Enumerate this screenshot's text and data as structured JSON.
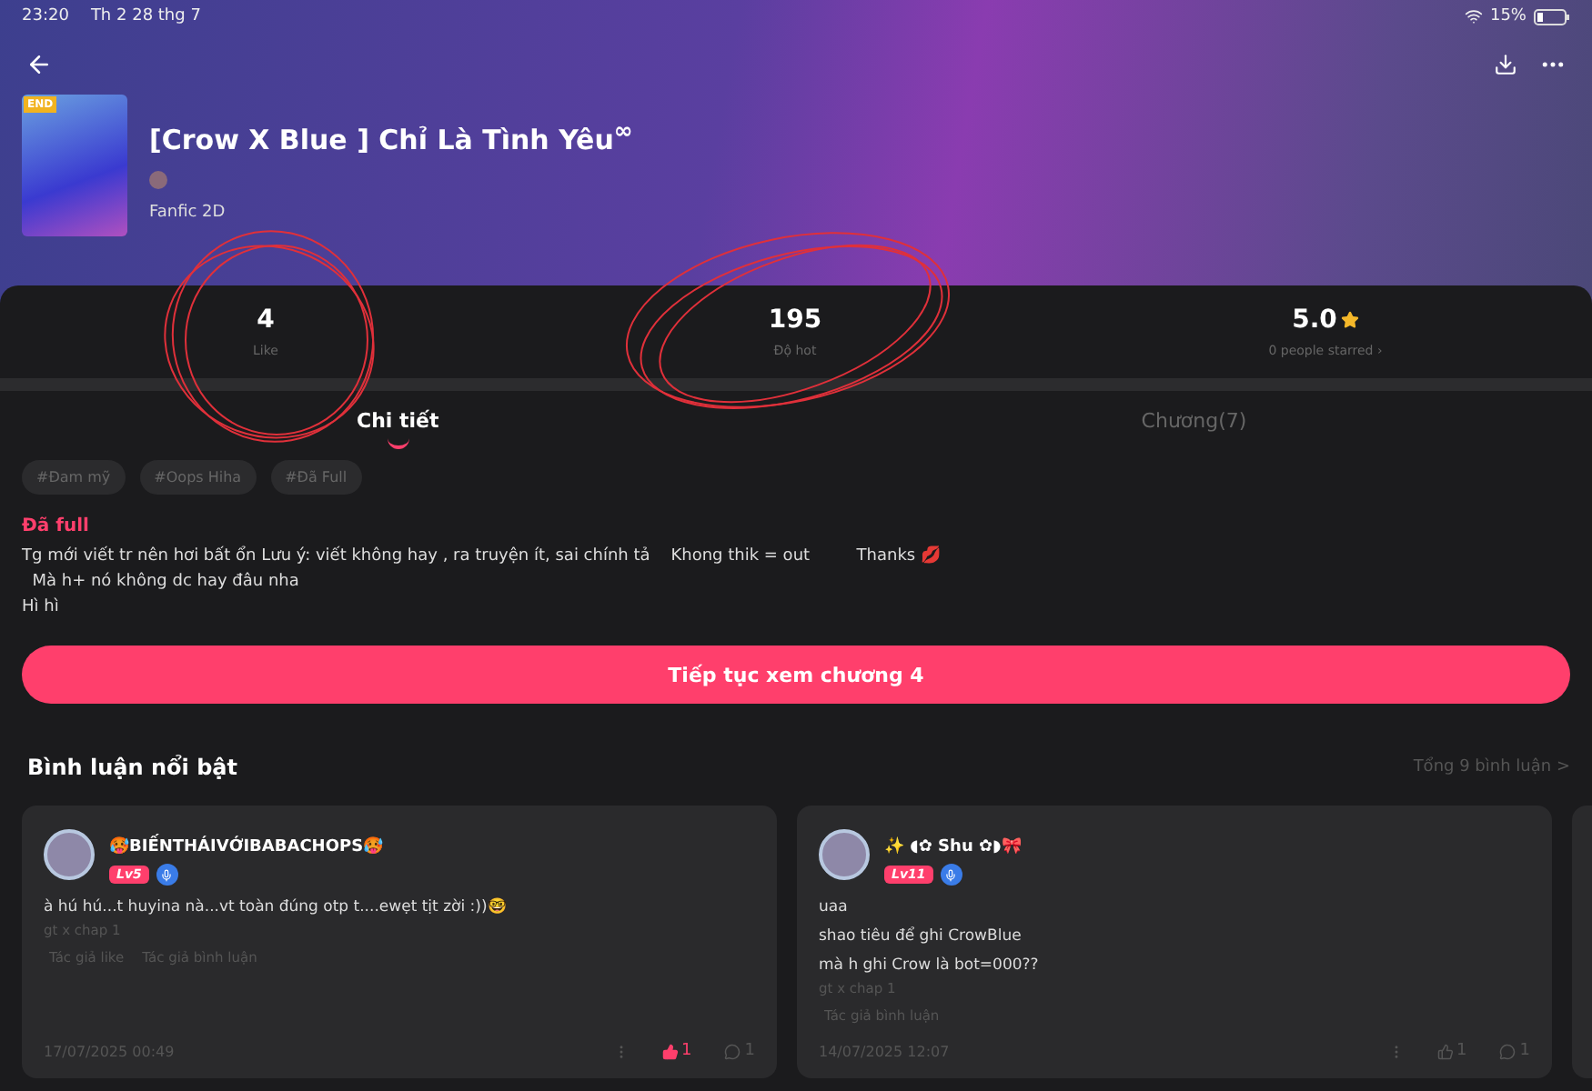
{
  "status_bar": {
    "time": "23:20",
    "date": "Th 2 28 thg 7",
    "battery": "15%"
  },
  "book": {
    "badge": "END",
    "title": "[Crow X Blue ] Chỉ Là Tình Yêu$^{∞}$",
    "category": "Fanfic 2D"
  },
  "stats": [
    {
      "kind": "count",
      "value": "4",
      "label": "Like"
    },
    {
      "kind": "count",
      "value": "195",
      "label": "Độ hot"
    },
    {
      "kind": "rating",
      "value": "5.0",
      "label": "0 people starred ›"
    }
  ],
  "tabs": [
    {
      "label": "Chi tiết",
      "selected": true
    },
    {
      "label": "Chương(7)",
      "selected": false
    }
  ],
  "tags": [
    "#Đam mỹ",
    "#Oops Hiha",
    "#Đã Full"
  ],
  "status": "Đã full",
  "description": [
    "Tg mới viết tr nên hơi bất ổn Lưu ý: viết không hay , ra truyện ít, sai chính tả    Khong thik = out         Thanks 💋",
    "  Mà h+ nó không dc hay đâu nha",
    "Hì hì"
  ],
  "continue_button": "Tiếp tục xem chương 4",
  "comments_section": {
    "title": "Bình luận nổi bật",
    "total": "Tổng 9 bình luận >"
  },
  "comments": [
    {
      "user": "🥵BIẾNTHÁIVỚIBABACHOPS🥵",
      "level": "Lv5",
      "lines": [
        "à hú hú...t huyina nà...vt toàn đúng otp t....ewẹt tịt zời :))🤓"
      ],
      "chapter": "gt x chap 1",
      "tags": [
        "Tác giả like",
        "Tác giả bình luận"
      ],
      "date": "17/07/2025 00:49",
      "likes": "1",
      "liked": true,
      "replies": "1"
    },
    {
      "user": "✨ ◖✿ Shu ✿◗🎀",
      "level": "Lv11",
      "lines": [
        "uaa",
        "shao tiêu để ghi CrowBlue",
        "mà h ghi Crow là bot=000??"
      ],
      "chapter": "gt x chap 1",
      "tags": [
        "Tác giả bình luận"
      ],
      "date": "14/07/2025 12:07",
      "likes": "1",
      "liked": false,
      "replies": "1"
    }
  ]
}
